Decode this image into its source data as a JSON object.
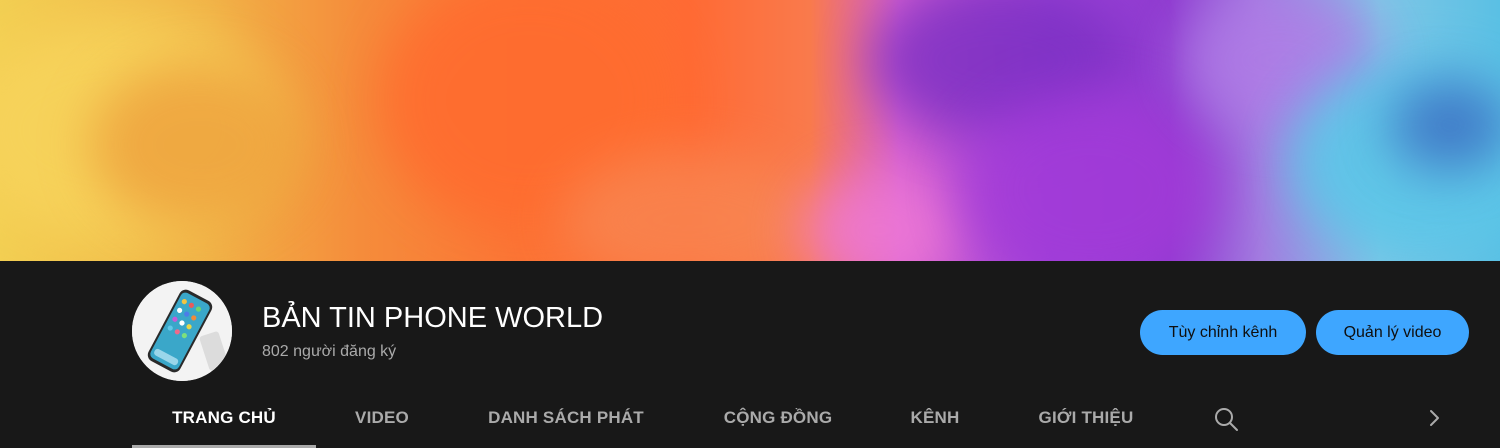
{
  "channel": {
    "name": "BẢN TIN PHONE WORLD",
    "subscribers": "802 người đăng ký"
  },
  "actions": {
    "customize_label": "Tùy chỉnh kênh",
    "manage_label": "Quản lý video"
  },
  "tabs": [
    {
      "label": "TRANG CHỦ",
      "active": true
    },
    {
      "label": "VIDEO",
      "active": false
    },
    {
      "label": "DANH SÁCH PHÁT",
      "active": false
    },
    {
      "label": "CỘNG ĐỒNG",
      "active": false
    },
    {
      "label": "KÊNH",
      "active": false
    },
    {
      "label": "GIỚI THIỆU",
      "active": false
    }
  ],
  "icons": {
    "search": "search-icon",
    "next": "chevron-right-icon"
  },
  "colors": {
    "background": "#181818",
    "accent": "#3ea6ff",
    "title": "#ffffff",
    "muted": "#aaaaaa"
  }
}
